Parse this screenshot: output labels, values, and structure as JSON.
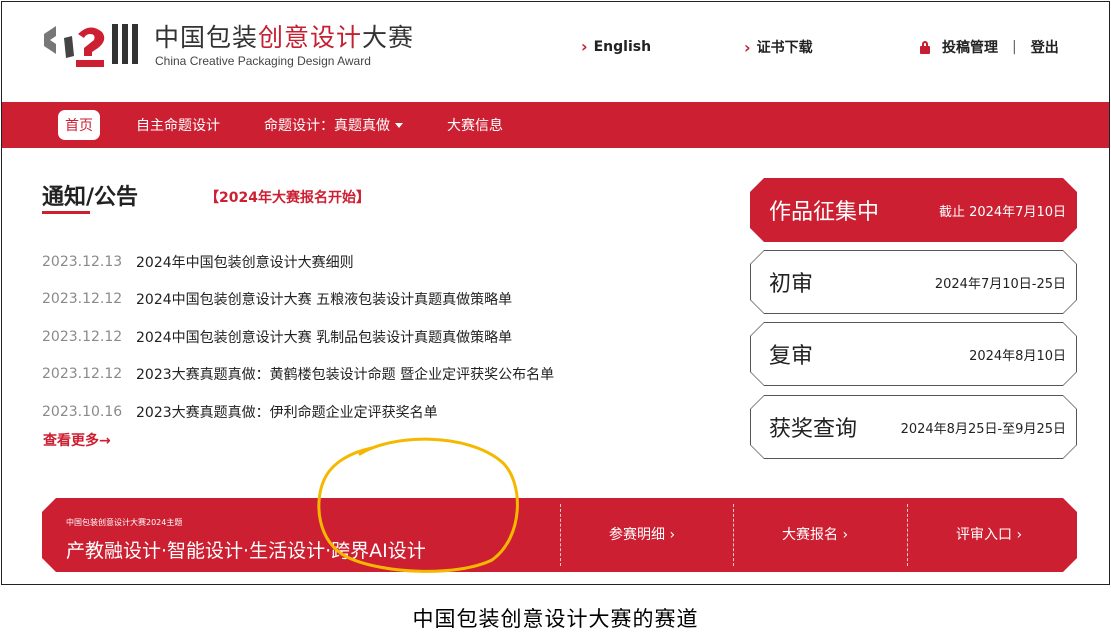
{
  "header": {
    "brand_cn_pre": "中国包装",
    "brand_cn_hl": "创意设计",
    "brand_cn_post": "大赛",
    "brand_en": "China Creative Packaging Design Award",
    "english_link": "English",
    "cert_link": "证书下载",
    "manage_link": "投稿管理",
    "separator": "|",
    "logout_link": "登出",
    "accent_color": "#cc1f31"
  },
  "nav": {
    "items": [
      {
        "label": "首页"
      },
      {
        "label": "自主命题设计"
      },
      {
        "label": "命题设计：真题真做"
      },
      {
        "label": "大赛信息"
      }
    ]
  },
  "notices": {
    "title": "通知/公告",
    "tag": "【2024年大赛报名开始】",
    "items": [
      {
        "date": "2023.12.13",
        "text": "2024年中国包装创意设计大赛细则"
      },
      {
        "date": "2023.12.12",
        "text": "2024中国包装创意设计大赛 五粮液包装设计真题真做策略单"
      },
      {
        "date": "2023.12.12",
        "text": "2024中国包装创意设计大赛 乳制品包装设计真题真做策略单"
      },
      {
        "date": "2023.12.12",
        "text": "2023大赛真题真做：黄鹤楼包装设计命题 暨企业定评获奖公布名单"
      },
      {
        "date": "2023.10.16",
        "text": "2023大赛真题真做：伊利命题企业定评获奖名单"
      }
    ],
    "more": "查看更多→"
  },
  "stages": [
    {
      "name": "作品征集中",
      "date": "截止 2024年7月10日"
    },
    {
      "name": "初审",
      "date": "2024年7月10日-25日"
    },
    {
      "name": "复审",
      "date": "2024年8月10日"
    },
    {
      "name": "获奖查询",
      "date": "2024年8月25日-至9月25日"
    }
  ],
  "banner": {
    "small": "中国包装创意设计大赛2024主题",
    "theme": "产教融设计·智能设计·生活设计·跨界AI设计",
    "links": [
      "参赛明细 ›",
      "大赛报名 ›",
      "评审入口 ›"
    ]
  },
  "annotation_color": "#f5b800",
  "caption": "中国包装创意设计大赛的赛道"
}
